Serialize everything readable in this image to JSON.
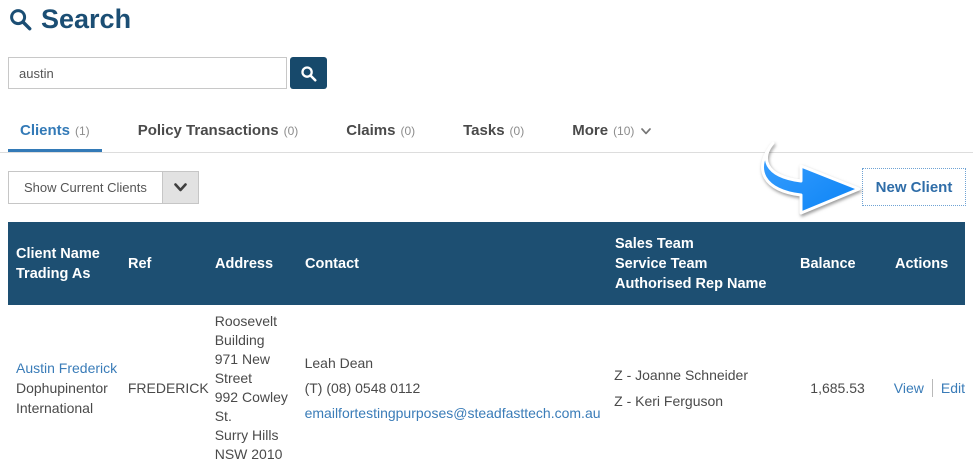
{
  "page": {
    "title": "Search"
  },
  "search": {
    "value": "austin"
  },
  "tabs": [
    {
      "label": "Clients",
      "count": "(1)",
      "active": true
    },
    {
      "label": "Policy Transactions",
      "count": "(0)",
      "active": false
    },
    {
      "label": "Claims",
      "count": "(0)",
      "active": false
    },
    {
      "label": "Tasks",
      "count": "(0)",
      "active": false
    },
    {
      "label": "More",
      "count": "(10)",
      "active": false,
      "has_dropdown": true
    }
  ],
  "filter": {
    "label": "Show Current Clients"
  },
  "toolbar": {
    "new_client_label": "New Client"
  },
  "table": {
    "headers": {
      "client_line1": "Client Name",
      "client_line2": "Trading As",
      "ref": "Ref",
      "address": "Address",
      "contact": "Contact",
      "sales_line1": "Sales Team",
      "sales_line2": "Service Team",
      "sales_line3": "Authorised Rep Name",
      "balance": "Balance",
      "actions": "Actions"
    },
    "row": {
      "client_name": "Austin Frederick",
      "trading_as": "Dophupinentor International",
      "ref": "FREDERICK",
      "address_lines": [
        "Roosevelt Building",
        "971 New Street",
        "992 Cowley St.",
        "Surry Hills NSW 2010"
      ],
      "contact_name": "Leah Dean",
      "contact_phone": "(T) (08) 0548 0112",
      "contact_email": "emailfortestingpurposes@steadfasttech.com.au",
      "teams": [
        "Z - Joanne Schneider",
        "Z - Keri Ferguson"
      ],
      "balance": "1,685.53",
      "view_label": "View",
      "edit_label": "Edit"
    }
  },
  "icons": {
    "title_icon": "magnifier",
    "search_button_icon": "magnifier",
    "more_tab_icon": "chevron-down",
    "filter_icon": "chevron-down",
    "annotation": "curved-arrow-pointer"
  },
  "colors": {
    "header_navy": "#1d4f72",
    "title_navy": "#1b4e74",
    "link_blue": "#3a7cb8",
    "active_tab_blue": "#337ab7",
    "arrow_blue": "#1e90ff",
    "body_text": "#4a4a4a"
  }
}
